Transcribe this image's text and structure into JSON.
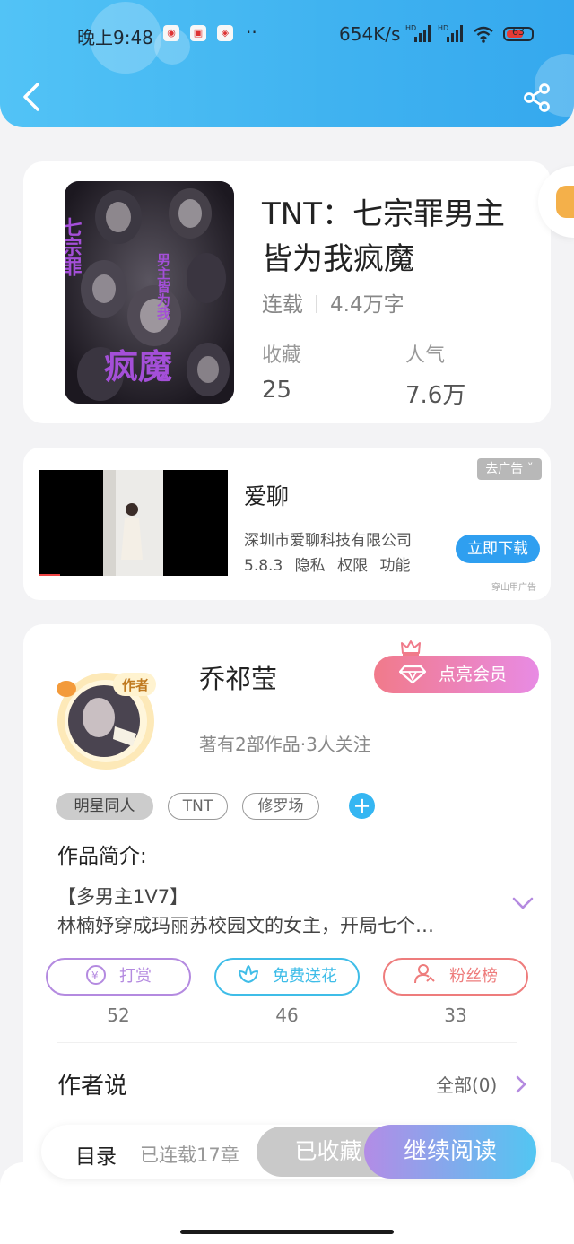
{
  "status_bar": {
    "time": "晚上9:48",
    "dots": "··",
    "speed": "654K/s",
    "battery": "63"
  },
  "book": {
    "title": "TNT：七宗罪男主皆为我疯魔",
    "status": "连载",
    "word_count": "4.4万字",
    "fav_label": "收藏",
    "fav_value": "25",
    "pop_label": "人气",
    "pop_value": "7.6万",
    "cover_text": {
      "a": "七宗罪",
      "b": "男主皆为我",
      "c": "疯魔"
    }
  },
  "ad": {
    "remove": "去广告",
    "name": "爱聊",
    "company": "深圳市爱聊科技有限公司",
    "version": "5.8.3",
    "privacy": "隐私",
    "perms": "权限",
    "features": "功能",
    "download": "立即下载",
    "source": "穿山甲广告"
  },
  "author": {
    "badge": "作者",
    "name": "乔祁莹",
    "vip_button": "点亮会员",
    "info": "著有2部作品·3人关注",
    "tags": [
      "明星同人",
      "TNT",
      "修罗场"
    ],
    "intro_heading": "作品简介:",
    "intro_line1": "【多男主1V7】",
    "intro_line2": "林楠妤穿成玛丽苏校园文的女主，开局七个…",
    "actions": [
      {
        "label": "打赏",
        "count": "52"
      },
      {
        "label": "免费送花",
        "count": "46"
      },
      {
        "label": "粉丝榜",
        "count": "33"
      }
    ],
    "says_heading": "作者说",
    "says_all": "全部(0)"
  },
  "bottom_bar": {
    "toc": "目录",
    "serialized": "已连载17章",
    "saved": "已收藏",
    "continue": "继续阅读"
  },
  "colors": {
    "header": "#3fb2f0",
    "vip_start": "#f17a8a",
    "vip_end": "#e88be4",
    "tip": "#b48ae0",
    "flower": "#3fbde8",
    "fans": "#ee7c7c",
    "download": "#2f9ff0"
  }
}
